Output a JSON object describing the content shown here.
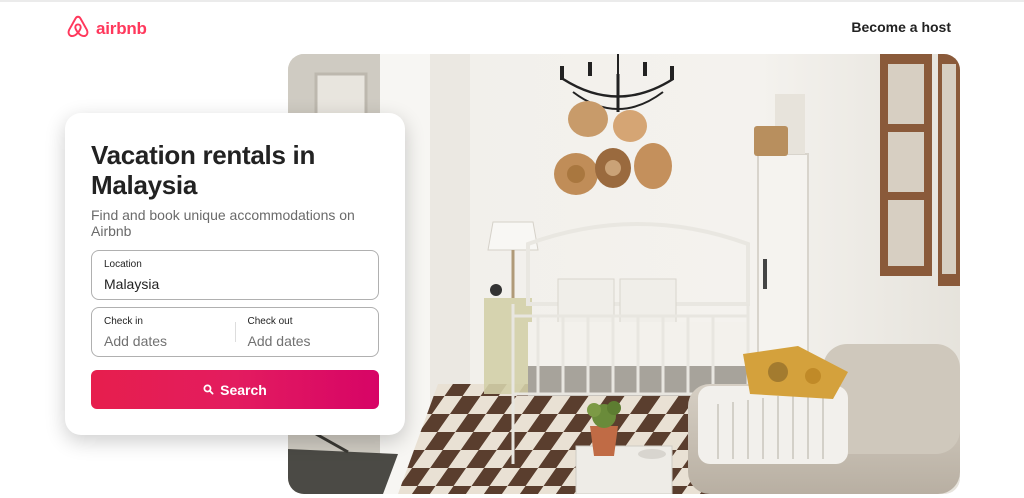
{
  "header": {
    "brand": "airbnb",
    "host_link": "Become a host"
  },
  "search_card": {
    "title": "Vacation rentals in Malaysia",
    "subtitle": "Find and book unique accommodations on Airbnb",
    "location": {
      "label": "Location",
      "value": "Malaysia"
    },
    "check_in": {
      "label": "Check in",
      "placeholder": "Add dates"
    },
    "check_out": {
      "label": "Check out",
      "placeholder": "Add dates"
    },
    "search_button": "Search"
  },
  "icons": {
    "logo": "airbnb-belo-icon",
    "search": "search-icon"
  },
  "colors": {
    "brand": "#ff385c",
    "button_start": "#e61e4d",
    "button_end": "#d70466",
    "text": "#222222",
    "muted": "#6a6a6a"
  }
}
